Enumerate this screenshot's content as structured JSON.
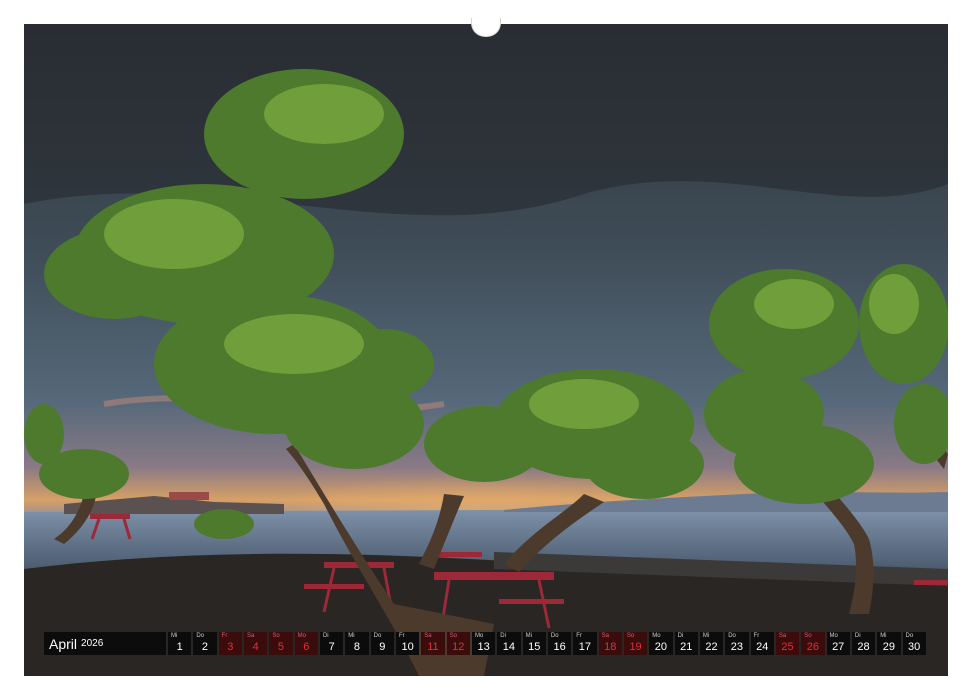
{
  "calendar": {
    "month": "April",
    "year": "2026",
    "days": [
      {
        "wd": "Mi",
        "d": "1",
        "red": false
      },
      {
        "wd": "Do",
        "d": "2",
        "red": false
      },
      {
        "wd": "Fr",
        "d": "3",
        "red": true
      },
      {
        "wd": "Sa",
        "d": "4",
        "red": true
      },
      {
        "wd": "So",
        "d": "5",
        "red": true
      },
      {
        "wd": "Mo",
        "d": "6",
        "red": true
      },
      {
        "wd": "Di",
        "d": "7",
        "red": false
      },
      {
        "wd": "Mi",
        "d": "8",
        "red": false
      },
      {
        "wd": "Do",
        "d": "9",
        "red": false
      },
      {
        "wd": "Fr",
        "d": "10",
        "red": false
      },
      {
        "wd": "Sa",
        "d": "11",
        "red": true
      },
      {
        "wd": "So",
        "d": "12",
        "red": true
      },
      {
        "wd": "Mo",
        "d": "13",
        "red": false
      },
      {
        "wd": "Di",
        "d": "14",
        "red": false
      },
      {
        "wd": "Mi",
        "d": "15",
        "red": false
      },
      {
        "wd": "Do",
        "d": "16",
        "red": false
      },
      {
        "wd": "Fr",
        "d": "17",
        "red": false
      },
      {
        "wd": "Sa",
        "d": "18",
        "red": true
      },
      {
        "wd": "So",
        "d": "19",
        "red": true
      },
      {
        "wd": "Mo",
        "d": "20",
        "red": false
      },
      {
        "wd": "Di",
        "d": "21",
        "red": false
      },
      {
        "wd": "Mi",
        "d": "22",
        "red": false
      },
      {
        "wd": "Do",
        "d": "23",
        "red": false
      },
      {
        "wd": "Fr",
        "d": "24",
        "red": false
      },
      {
        "wd": "Sa",
        "d": "25",
        "red": true
      },
      {
        "wd": "So",
        "d": "26",
        "red": true
      },
      {
        "wd": "Mo",
        "d": "27",
        "red": false
      },
      {
        "wd": "Di",
        "d": "28",
        "red": false
      },
      {
        "wd": "Mi",
        "d": "29",
        "red": false
      },
      {
        "wd": "Do",
        "d": "30",
        "red": false
      }
    ]
  },
  "colors": {
    "holiday_text": "#e0303a",
    "bar_background": "#0c0c0c"
  }
}
